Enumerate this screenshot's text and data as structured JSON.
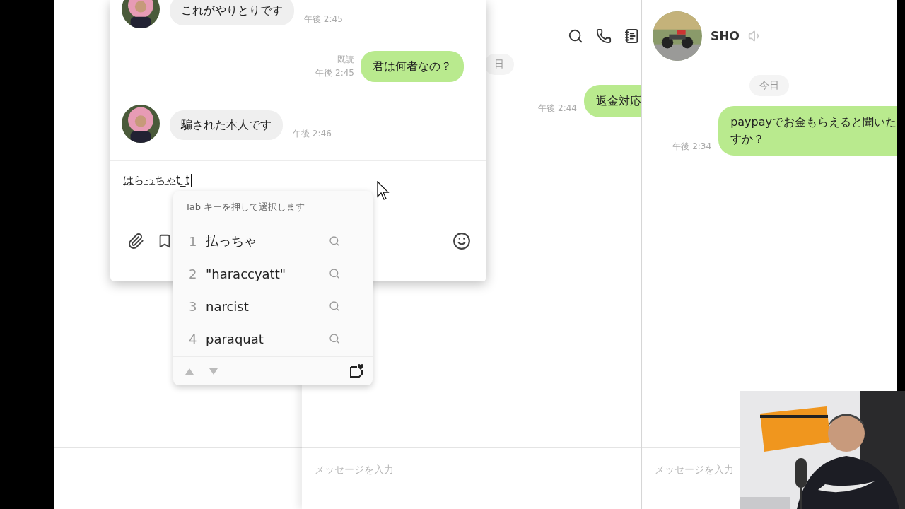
{
  "front_chat": {
    "messages": [
      {
        "kind": "received",
        "text": "これがやりとりです",
        "time": "午後 2:45"
      },
      {
        "kind": "sent",
        "read": "既読",
        "text": "君は何者なの？",
        "time": "午後 2:45"
      },
      {
        "kind": "received",
        "text": "騙された本人です",
        "time": "午後 2:46"
      }
    ],
    "composer": {
      "value": "はらっちゃt_t"
    }
  },
  "ime": {
    "hint": "Tab キーを押して選択します",
    "candidates": [
      {
        "number": "1",
        "text": "払っちゃ"
      },
      {
        "number": "2",
        "text": "\"haraccyatt\""
      },
      {
        "number": "3",
        "text": "narcist"
      },
      {
        "number": "4",
        "text": "paraquat"
      }
    ]
  },
  "middle_chat": {
    "date": "日",
    "messages": [
      {
        "kind": "sent",
        "lines": [
          "返金対応"
        ],
        "time": "午後 2:44"
      }
    ],
    "composer": {
      "placeholder": "メッセージを入力"
    }
  },
  "right_chat": {
    "contact": "SHO",
    "date": "今日",
    "messages": [
      {
        "kind": "sent",
        "lines": [
          "paypayでお金もらえると聞いた",
          "すか？"
        ],
        "time": "午後 2:34"
      }
    ],
    "composer": {
      "placeholder": "メッセージを入力"
    }
  }
}
